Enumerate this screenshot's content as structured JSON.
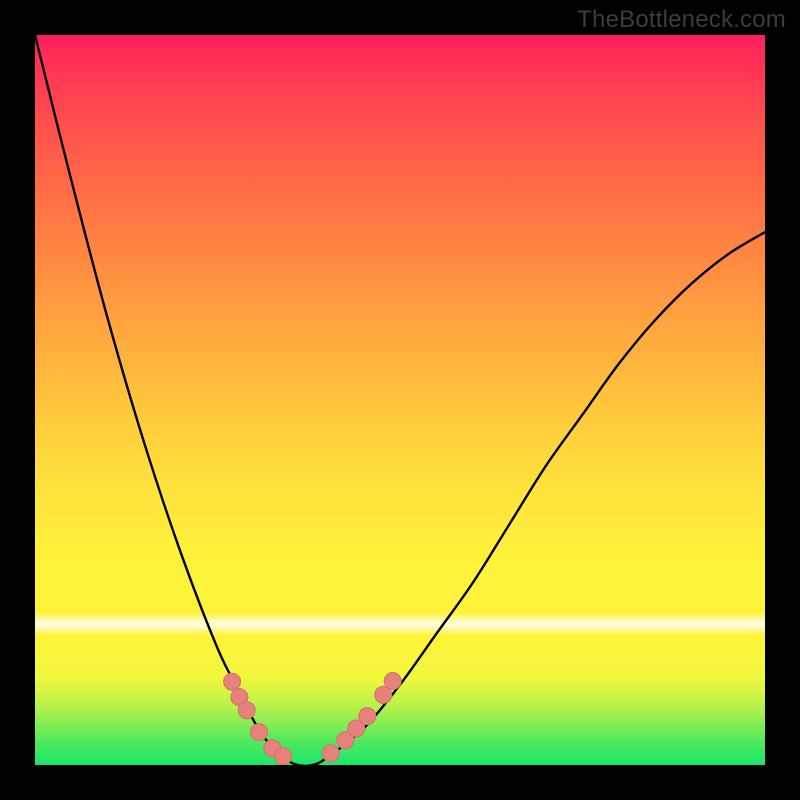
{
  "watermark": "TheBottleneck.com",
  "colors": {
    "frame": "#000000",
    "curve_stroke": "#000000",
    "marker_fill": "#e6817b",
    "marker_stroke": "#d96f69",
    "gradient_top": "#ff1a5e",
    "gradient_mid": "#fff23a",
    "gradient_bottom": "#17e86a"
  },
  "chart_data": {
    "type": "line",
    "title": "",
    "xlabel": "",
    "ylabel": "",
    "xlim": [
      0,
      100
    ],
    "ylim": [
      0,
      100
    ],
    "legend": false,
    "grid": false,
    "series": [
      {
        "name": "bottleneck-curve",
        "x": [
          0,
          5,
          10,
          15,
          20,
          25,
          28,
          30,
          32,
          34,
          36,
          38,
          40,
          45,
          50,
          55,
          60,
          65,
          70,
          75,
          80,
          85,
          90,
          95,
          100
        ],
        "values": [
          100,
          80,
          61,
          44,
          29,
          16,
          10,
          6,
          3,
          1,
          0,
          0,
          1,
          5,
          11,
          18,
          25,
          33,
          41,
          48,
          55,
          61,
          66,
          70,
          73
        ]
      }
    ],
    "markers": [
      {
        "x": 27.0,
        "y": 11.4
      },
      {
        "x": 28.0,
        "y": 9.3
      },
      {
        "x": 29.0,
        "y": 7.5
      },
      {
        "x": 30.7,
        "y": 4.5
      },
      {
        "x": 32.5,
        "y": 2.3
      },
      {
        "x": 34.0,
        "y": 1.2
      },
      {
        "x": 40.5,
        "y": 1.6
      },
      {
        "x": 42.5,
        "y": 3.4
      },
      {
        "x": 44.0,
        "y": 5.0
      },
      {
        "x": 45.5,
        "y": 6.7
      },
      {
        "x": 47.7,
        "y": 9.6
      },
      {
        "x": 49.0,
        "y": 11.5
      }
    ],
    "gradient_bands": [
      {
        "color": "green",
        "from_y": 0,
        "to_y": 3
      },
      {
        "color": "yellow",
        "from_y": 3,
        "to_y": 50
      },
      {
        "color": "orange",
        "from_y": 50,
        "to_y": 80
      },
      {
        "color": "red",
        "from_y": 80,
        "to_y": 100
      }
    ]
  }
}
